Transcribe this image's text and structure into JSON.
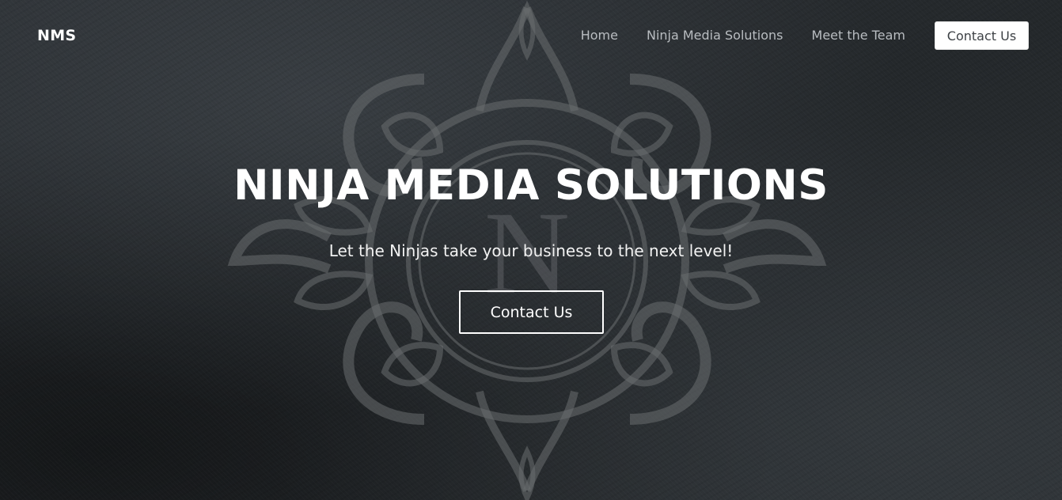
{
  "navbar": {
    "brand": "NMS",
    "links": [
      {
        "label": "Home"
      },
      {
        "label": "Ninja Media Solutions"
      },
      {
        "label": "Meet the Team"
      }
    ],
    "contact_button": "Contact Us"
  },
  "hero": {
    "title": "NINJA MEDIA SOLUTIONS",
    "subtitle": "Let the Ninjas take your business to the next level!",
    "cta_button": "Contact Us",
    "emblem_letter": "N"
  },
  "colors": {
    "background": "#25292c",
    "text": "#ffffff",
    "nav_link": "#b9bdc1",
    "emblem": "#6a6d70"
  }
}
